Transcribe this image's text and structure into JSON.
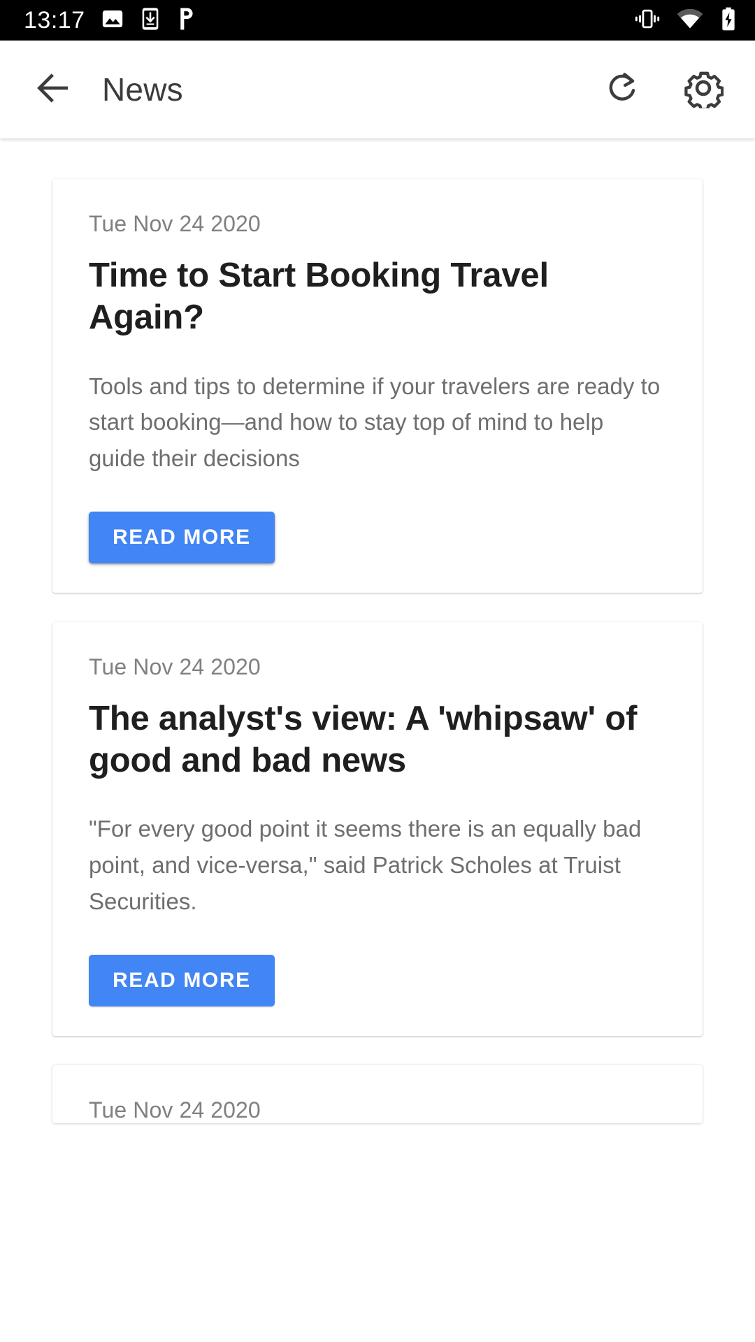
{
  "status_bar": {
    "time": "13:17",
    "left_icons": [
      "photo-icon",
      "download-to-device-icon",
      "parking-p-icon"
    ],
    "right_icons": [
      "vibrate-icon",
      "wifi-icon",
      "battery-charging-icon"
    ],
    "background_color": "#000000",
    "foreground_color": "#ffffff"
  },
  "appbar": {
    "title": "News",
    "back_icon": "arrow-left-icon",
    "refresh_icon": "refresh-icon",
    "settings_icon": "gear-icon",
    "background_color": "#ffffff",
    "text_color": "#3c3c3c"
  },
  "theme": {
    "accent_color": "#4285f4",
    "card_background": "#ffffff",
    "date_color": "#808080",
    "title_color": "#1f1f1f",
    "body_color": "#6e6e6e"
  },
  "articles": [
    {
      "date": "Tue Nov 24 2020",
      "title": "Time to Start Booking Travel Again?",
      "description": "Tools and tips to determine if your travelers are ready to start booking—and how to stay top of mind to help guide their decisions",
      "button_label": "READ MORE"
    },
    {
      "date": "Tue Nov 24 2020",
      "title": "The analyst's view: A 'whipsaw' of good and bad news",
      "description": "\"For every good point it seems there is an equally bad point, and vice-versa,\" said Patrick Scholes at Truist Securities.",
      "button_label": "READ MORE"
    },
    {
      "date": "Tue Nov 24 2020"
    }
  ]
}
